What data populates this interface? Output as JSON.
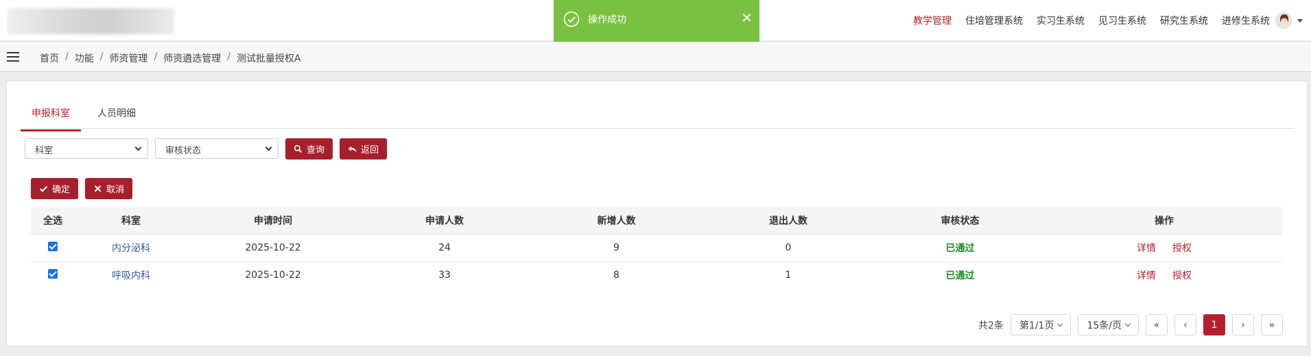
{
  "toast": {
    "message": "操作成功",
    "close": "✕"
  },
  "topnav": [
    "教学管理",
    "住培管理系统",
    "实习生系统",
    "见习生系统",
    "研究生系统",
    "进修生系统"
  ],
  "breadcrumb": [
    "首页",
    "功能",
    "师资管理",
    "师资遴选管理",
    "测试批量授权A"
  ],
  "tabs": [
    "申报科室",
    "人员明细"
  ],
  "filters": {
    "dept": "科室",
    "status": "审核状态",
    "query": "查询",
    "back": "返回"
  },
  "actions": {
    "confirm": "确定",
    "cancel": "取消"
  },
  "table": {
    "headers": [
      "全选",
      "科室",
      "申请时间",
      "申请人数",
      "新增人数",
      "退出人数",
      "审核状态",
      "操作"
    ],
    "rows": [
      {
        "dept": "内分泌科",
        "date": "2025-10-22",
        "apply": "24",
        "added": "9",
        "exit": "0",
        "status": "已通过",
        "op1": "详情",
        "op2": "授权"
      },
      {
        "dept": "呼吸内科",
        "date": "2025-10-22",
        "apply": "33",
        "added": "8",
        "exit": "1",
        "status": "已通过",
        "op1": "详情",
        "op2": "授权"
      }
    ]
  },
  "pager": {
    "total": "共2条",
    "page": "第1/1页",
    "size": "15条/页",
    "first": "«",
    "prev": "‹",
    "current": "1",
    "next": "›",
    "last": "»"
  }
}
